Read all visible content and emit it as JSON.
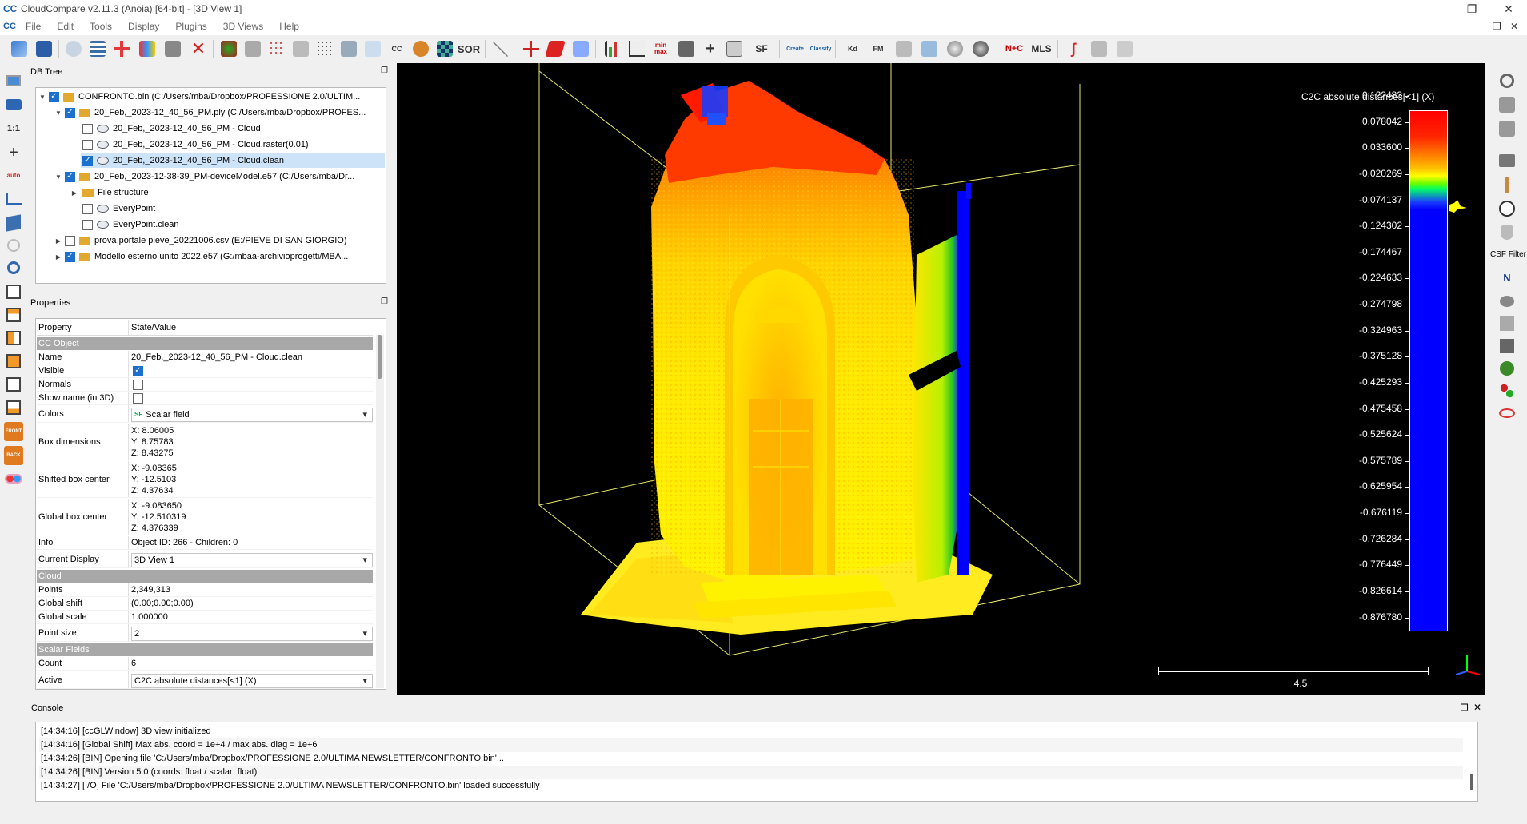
{
  "window": {
    "title": "CloudCompare v2.11.3 (Anoia) [64-bit] - [3D View 1]",
    "logo_text": "CC",
    "controls": [
      "—",
      "❐",
      "✕"
    ],
    "mdi_controls": [
      "❐",
      "✕"
    ]
  },
  "menu": [
    "File",
    "Edit",
    "Tools",
    "Display",
    "Plugins",
    "3D Views",
    "Help"
  ],
  "toolbar": {
    "labels": [
      "SOR",
      "CC",
      "SF",
      "Kd",
      "FM",
      "N+C",
      "MLS",
      "Create",
      "Classify",
      "min max",
      "auto"
    ]
  },
  "left_toolbar": {
    "one_to_one": "1:1",
    "auto": "auto",
    "front": "FRONT",
    "back": "BACK"
  },
  "right_toolbar": {
    "csf_label": "CSF Filter",
    "north_label": "N"
  },
  "db_tree": {
    "title": "DB Tree",
    "items": [
      {
        "label": "CONFRONTO.bin (C:/Users/mba/Dropbox/PROFESSIONE 2.0/ULTIM...",
        "checked": true
      },
      {
        "label": "20_Feb,_2023-12_40_56_PM.ply (C:/Users/mba/Dropbox/PROFES...",
        "checked": true
      },
      {
        "label": "20_Feb,_2023-12_40_56_PM - Cloud",
        "checked": false
      },
      {
        "label": "20_Feb,_2023-12_40_56_PM - Cloud.raster(0.01)",
        "checked": false
      },
      {
        "label": "20_Feb,_2023-12_40_56_PM - Cloud.clean",
        "checked": true
      },
      {
        "label": "20_Feb,_2023-12-38-39_PM-deviceModel.e57 (C:/Users/mba/Dr...",
        "checked": true
      },
      {
        "label": "File structure"
      },
      {
        "label": "EveryPoint",
        "checked": false
      },
      {
        "label": "EveryPoint.clean",
        "checked": false
      },
      {
        "label": "prova portale pieve_20221006.csv (E:/PIEVE DI SAN GIORGIO)",
        "checked": false
      },
      {
        "label": "Modello esterno unito 2022.e57 (G:/mbaa-archivioprogetti/MBA...",
        "checked": true
      }
    ]
  },
  "properties": {
    "title": "Properties",
    "header": {
      "property": "Property",
      "value": "State/Value"
    },
    "sections": {
      "cc_object": "CC Object",
      "cloud": "Cloud",
      "scalar_fields": "Scalar Fields"
    },
    "rows": {
      "name": {
        "k": "Name",
        "v": "20_Feb,_2023-12_40_56_PM - Cloud.clean"
      },
      "visible": {
        "k": "Visible",
        "checked": true
      },
      "normals": {
        "k": "Normals",
        "checked": false
      },
      "show_name": {
        "k": "Show name (in 3D)",
        "checked": false
      },
      "colors": {
        "k": "Colors",
        "v": "Scalar field"
      },
      "box_dimensions": {
        "k": "Box dimensions",
        "x": "X: 8.06005",
        "y": "Y: 8.75783",
        "z": "Z: 8.43275"
      },
      "shifted_box_center": {
        "k": "Shifted box center",
        "x": "X: -9.08365",
        "y": "Y: -12.5103",
        "z": "Z: 4.37634"
      },
      "global_box_center": {
        "k": "Global box center",
        "x": "X: -9.083650",
        "y": "Y: -12.510319",
        "z": "Z: 4.376339"
      },
      "info": {
        "k": "Info",
        "v": "Object ID: 266 - Children: 0"
      },
      "current_display": {
        "k": "Current Display",
        "v": "3D View 1"
      },
      "points": {
        "k": "Points",
        "v": "2,349,313"
      },
      "global_shift": {
        "k": "Global shift",
        "v": "(0.00;0.00;0.00)"
      },
      "global_scale": {
        "k": "Global scale",
        "v": "1.000000"
      },
      "point_size": {
        "k": "Point size",
        "v": "2"
      },
      "count": {
        "k": "Count",
        "v": "6"
      },
      "active": {
        "k": "Active",
        "v": "C2C absolute distances[<1] (X)"
      }
    }
  },
  "view3d": {
    "scalar_field_title": "C2C absolute distances[<1] (X)",
    "color_scale_labels": [
      "0.122483",
      "0.078042",
      "0.033600",
      "-0.020269",
      "-0.074137",
      "-0.124302",
      "-0.174467",
      "-0.224633",
      "-0.274798",
      "-0.324963",
      "-0.375128",
      "-0.425293",
      "-0.475458",
      "-0.525624",
      "-0.575789",
      "-0.625954",
      "-0.676119",
      "-0.726284",
      "-0.776449",
      "-0.826614",
      "-0.876780"
    ],
    "scale_bar_label": "4.5",
    "colors": {
      "high": "#ff0000",
      "mid": "#ffff00",
      "low": "#0000ff",
      "bbox": "#e6e66a"
    }
  },
  "console": {
    "title": "Console",
    "lines": [
      "[14:34:16] [ccGLWindow] 3D view initialized",
      "[14:34:16] [Global Shift] Max abs. coord = 1e+4 / max abs. diag = 1e+6",
      "[14:34:26] [BIN] Opening file 'C:/Users/mba/Dropbox/PROFESSIONE 2.0/ULTIMA NEWSLETTER/CONFRONTO.bin'...",
      "[14:34:26] [BIN] Version 5.0 (coords: float / scalar: float)",
      "[14:34:27] [I/O] File 'C:/Users/mba/Dropbox/PROFESSIONE 2.0/ULTIMA NEWSLETTER/CONFRONTO.bin' loaded successfully"
    ]
  }
}
